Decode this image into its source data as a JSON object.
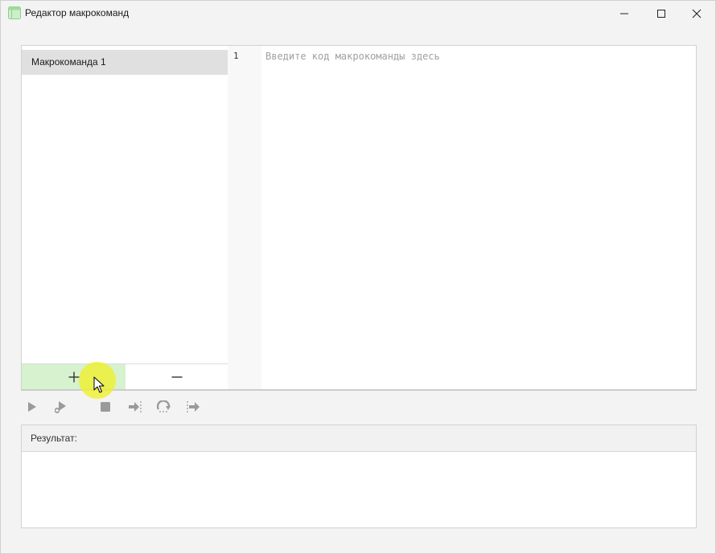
{
  "window": {
    "title": "Редактор макрокоманд",
    "icon": "macro-editor-app-icon",
    "controls": [
      "minimize-icon",
      "maximize-icon",
      "close-icon"
    ]
  },
  "macros": {
    "items": [
      {
        "label": "Макрокоманда 1",
        "selected": true
      }
    ],
    "add_icon": "plus-icon",
    "remove_icon": "minus-icon"
  },
  "editor": {
    "line_numbers": [
      "1"
    ],
    "placeholder": "Введите код макрокоманды здесь"
  },
  "toolbar": {
    "buttons": [
      "play-icon",
      "debug-icon",
      "stop-icon",
      "step-into-icon",
      "step-over-icon",
      "step-out-icon"
    ]
  },
  "result": {
    "label": "Результат:"
  },
  "colors": {
    "add_button_bg": "#d6f2cf",
    "selected_item_bg": "#e0e0e0",
    "disabled_icon": "#9a9a9a",
    "cursor_highlight": "#f0f028"
  }
}
